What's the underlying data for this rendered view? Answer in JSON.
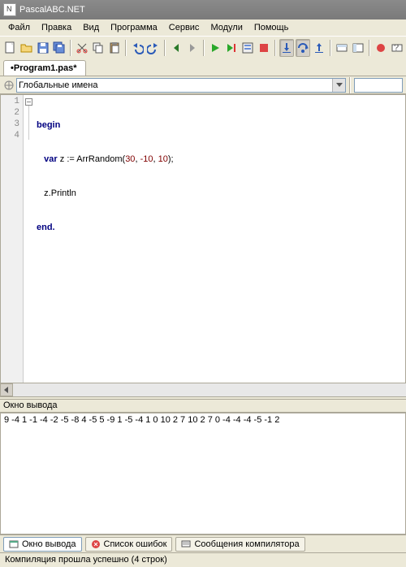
{
  "app": {
    "title": "PascalABC.NET"
  },
  "menu": [
    "Файл",
    "Правка",
    "Вид",
    "Программа",
    "Сервис",
    "Модули",
    "Помощь"
  ],
  "tab": {
    "name": "Program1.pas*",
    "modified": true
  },
  "combo": {
    "label": "Глобальные имена"
  },
  "code": {
    "lines": [
      {
        "n": 1,
        "kw1": "begin"
      },
      {
        "n": 2,
        "kw": "var",
        "id": "z",
        "op": ":=",
        "fn": "ArrRandom",
        "args": [
          "30",
          "-10",
          "10"
        ]
      },
      {
        "n": 3,
        "call": "z.Println"
      },
      {
        "n": 4,
        "kw1": "end."
      }
    ]
  },
  "output_panel": {
    "title": "Окно вывода",
    "text": "9 -4 1 -1 -4 -2 -5 -8 4 -5 5 -9 1 -5 -4 1 0 10 2 7 10 2 7 0 -4 -4 -4 -5 -1 2"
  },
  "bottom_tabs": [
    {
      "label": "Окно вывода",
      "active": true,
      "icon": "output"
    },
    {
      "label": "Список ошибок",
      "active": false,
      "icon": "errors"
    },
    {
      "label": "Сообщения компилятора",
      "active": false,
      "icon": "messages"
    }
  ],
  "status": {
    "text": "Компиляция прошла успешно (4 строк)"
  }
}
